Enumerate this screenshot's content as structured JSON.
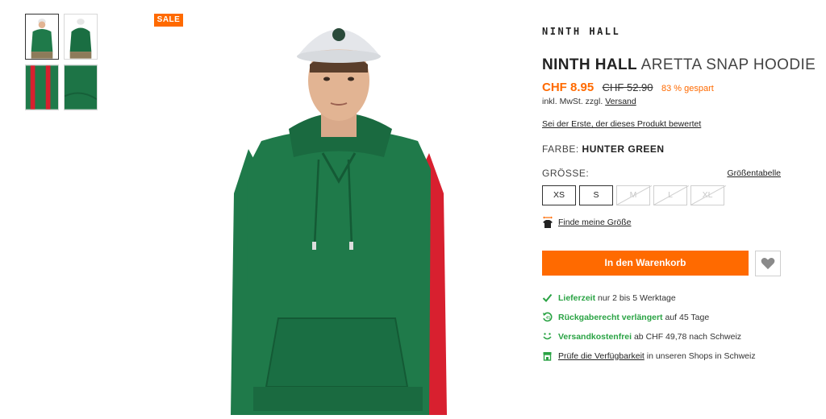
{
  "gallery": {
    "sale_badge": "SALE",
    "thumbnails": [
      "front-view",
      "back-view",
      "sleeve-detail",
      "fabric-detail"
    ]
  },
  "product": {
    "brand_logo": "NINTH HALL",
    "brand": "NINTH HALL",
    "name": "ARETTA SNAP HOODIE",
    "price_current": "CHF 8.95",
    "price_original": "CHF 52.90",
    "savings": "83 % gespart",
    "tax_note": "inkl. MwSt. zzgl.",
    "shipping_link": "Versand",
    "review_link": "Sei der Erste, der dieses Produkt bewertet",
    "color_label": "FARBE:",
    "color_value": "HUNTER GREEN",
    "size_label": "GRÖSSE:",
    "size_chart_link": "Größentabelle",
    "sizes": [
      {
        "label": "XS",
        "available": true
      },
      {
        "label": "S",
        "available": true
      },
      {
        "label": "M",
        "available": false
      },
      {
        "label": "L",
        "available": false
      },
      {
        "label": "XL",
        "available": false
      }
    ],
    "find_size_link": "Finde meine Größe",
    "add_to_cart": "In den Warenkorb"
  },
  "usps": [
    {
      "highlight": "Lieferzeit",
      "text": "nur 2 bis 5 Werktage",
      "icon": "check-icon"
    },
    {
      "highlight": "Rückgaberecht verlängert",
      "text": "auf 45 Tage",
      "icon": "return-icon"
    },
    {
      "highlight": "Versandkostenfrei",
      "text": "ab CHF 49,78 nach Schweiz",
      "icon": "smile-icon"
    },
    {
      "link": "Prüfe die Verfügbarkeit",
      "text": "in unseren Shops in Schweiz",
      "icon": "store-icon"
    }
  ],
  "colors": {
    "accent": "#ff6a00",
    "success": "#2aa344",
    "hoodie": "#1f7a4a",
    "stripe": "#d8202f"
  }
}
